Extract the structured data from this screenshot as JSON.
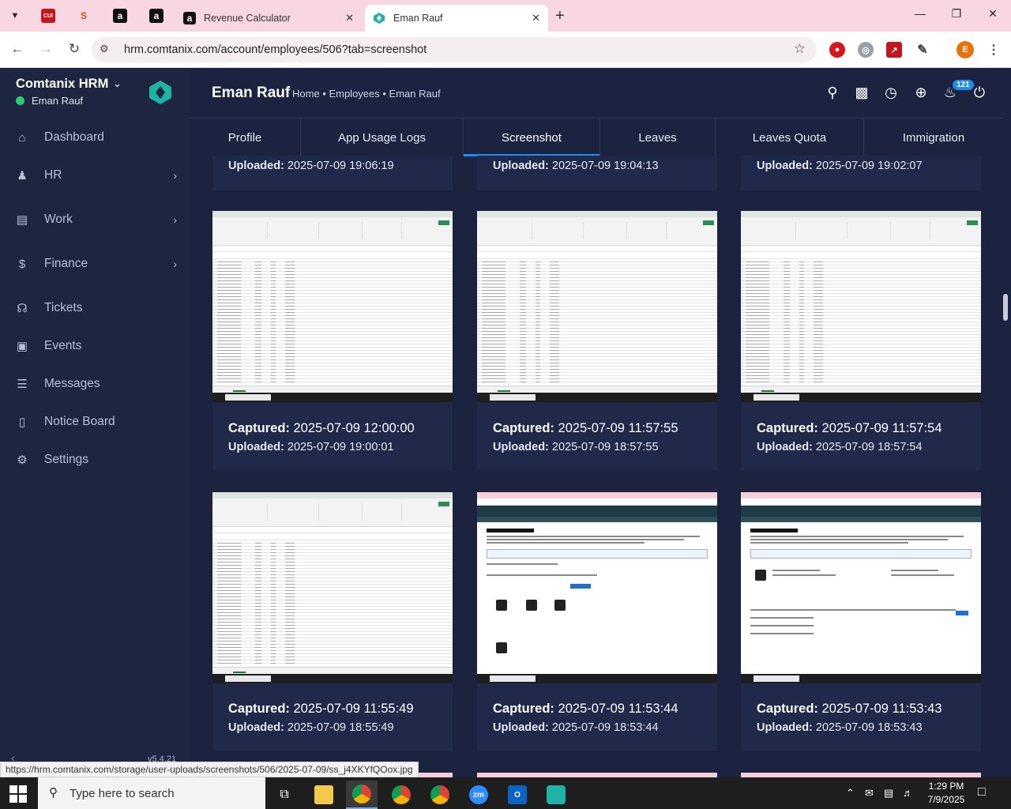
{
  "browser": {
    "tabs": [
      {
        "title": "Revenue Calculator",
        "favicon": "amazon-icon"
      },
      {
        "title": "Eman Rauf",
        "favicon": "comtanix-icon",
        "active": true
      }
    ],
    "pinned_tabs": [
      {
        "icon": "red-app-icon",
        "label": "CUI"
      },
      {
        "icon": "scribble-icon",
        "label": "S"
      },
      {
        "icon": "amazon-icon",
        "label": "a"
      },
      {
        "icon": "amazon-icon",
        "label": "a"
      }
    ],
    "url": "hrm.comtanix.com/account/employees/506?tab=screenshot",
    "profile_initial": "E",
    "status_url": "https://hrm.comtanix.com/storage/user-uploads/screenshots/506/2025-07-09/ss_j4XKYfQOox.jpg"
  },
  "sidebar": {
    "brand": "Comtanix HRM",
    "user": "Eman Rauf",
    "version": "v5.4.21",
    "items": [
      {
        "label": "Dashboard",
        "icon": "home-icon",
        "has_children": false
      },
      {
        "label": "HR",
        "icon": "users-icon",
        "has_children": true
      },
      {
        "label": "Work",
        "icon": "briefcase-icon",
        "has_children": true
      },
      {
        "label": "Finance",
        "icon": "dollar-icon",
        "has_children": true
      },
      {
        "label": "Tickets",
        "icon": "headset-icon",
        "has_children": false
      },
      {
        "label": "Events",
        "icon": "calendar-icon",
        "has_children": false
      },
      {
        "label": "Messages",
        "icon": "message-icon",
        "has_children": false
      },
      {
        "label": "Notice Board",
        "icon": "clipboard-icon",
        "has_children": false
      },
      {
        "label": "Settings",
        "icon": "gear-icon",
        "has_children": false
      }
    ]
  },
  "header": {
    "title": "Eman Rauf",
    "breadcrumb": "Home • Employees • Eman Rauf",
    "notification_count": "121"
  },
  "tabs": [
    "Profile",
    "App Usage Logs",
    "Screenshot",
    "Leaves",
    "Leaves Quota",
    "Immigration"
  ],
  "active_tab": "Screenshot",
  "labels": {
    "captured": "Captured:",
    "uploaded": "Uploaded:"
  },
  "top_partial_row": [
    {
      "uploaded": "2025-07-09 19:06:19"
    },
    {
      "uploaded": "2025-07-09 19:04:13"
    },
    {
      "uploaded": "2025-07-09 19:02:07"
    }
  ],
  "screenshots": [
    {
      "captured": "2025-07-09 12:00:00",
      "uploaded": "2025-07-09 19:00:01",
      "kind": "spreadsheet"
    },
    {
      "captured": "2025-07-09 11:57:55",
      "uploaded": "2025-07-09 18:57:55",
      "kind": "spreadsheet"
    },
    {
      "captured": "2025-07-09 11:57:54",
      "uploaded": "2025-07-09 18:57:54",
      "kind": "spreadsheet"
    },
    {
      "captured": "2025-07-09 11:55:49",
      "uploaded": "2025-07-09 18:55:49",
      "kind": "spreadsheet"
    },
    {
      "captured": "2025-07-09 11:53:44",
      "uploaded": "2025-07-09 18:53:44",
      "kind": "revenue-calculator"
    },
    {
      "captured": "2025-07-09 11:53:43",
      "uploaded": "2025-07-09 18:53:43",
      "kind": "revenue-calculator"
    }
  ],
  "taskbar": {
    "search_placeholder": "Type here to search",
    "time": "1:29 PM",
    "date": "7/9/2025"
  }
}
